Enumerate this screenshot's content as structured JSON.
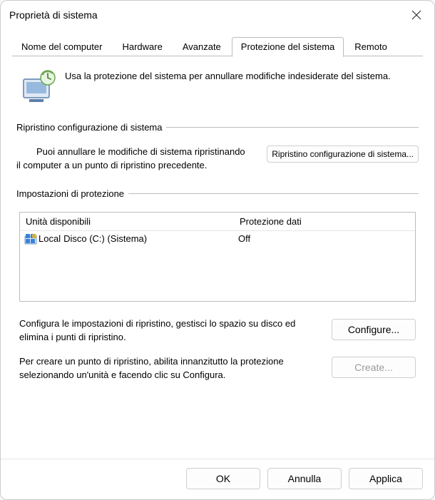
{
  "window": {
    "title": "Proprietà di sistema"
  },
  "tabs": {
    "computer_name": "Nome del computer",
    "hardware": "Hardware",
    "advanced": "Avanzate",
    "protection": "Protezione del sistema",
    "remote": "Remoto"
  },
  "intro": {
    "text": "Usa la protezione del sistema per annullare modifiche indesiderate del sistema."
  },
  "restore_group": {
    "title": "Ripristino configurazione di sistema",
    "desc_line1": "Puoi annullare le modifiche di sistema ripristinando",
    "desc_line2": "il computer a un punto di ripristino precedente.",
    "button": "Ripristino configurazione di sistema..."
  },
  "settings_group": {
    "title": "Impostazioni di protezione",
    "col_drives": "Unità disponibili",
    "col_protection": "Protezione dati",
    "row1_name_prefix": "Local",
    "row1_name_rest": "Disco (C:) (Sistema)",
    "row1_status": "Off",
    "configure_desc": "Configura le impostazioni di ripristino, gestisci lo spazio su disco ed elimina i punti di ripristino.",
    "configure_button": "Configure...",
    "create_desc": "Per creare un punto di ripristino, abilita innanzitutto la protezione selezionando un'unità e facendo clic su Configura.",
    "create_button": "Create..."
  },
  "footer": {
    "ok": "OK",
    "cancel": "Annulla",
    "apply": "Applica"
  }
}
